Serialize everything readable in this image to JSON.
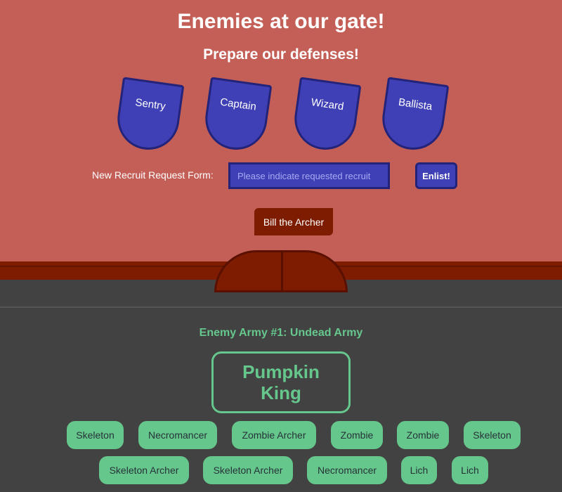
{
  "header": {
    "title": "Enemies at our gate!",
    "subtitle": "Prepare our defenses!"
  },
  "defenders": [
    {
      "label": "Sentry"
    },
    {
      "label": "Captain"
    },
    {
      "label": "Wizard"
    },
    {
      "label": "Ballista"
    }
  ],
  "recruit_form": {
    "label": "New Recruit Request Form:",
    "placeholder": "Please indicate requested recruit",
    "value": "",
    "enlist_label": "Enlist!"
  },
  "recruit": {
    "label": "Bill the Archer"
  },
  "enemy_army": {
    "title": "Enemy Army #1: Undead Army",
    "boss": "Pumpkin King",
    "units": [
      {
        "label": "Skeleton"
      },
      {
        "label": "Necromancer"
      },
      {
        "label": "Zombie Archer"
      },
      {
        "label": "Zombie"
      },
      {
        "label": "Zombie"
      },
      {
        "label": "Skeleton"
      },
      {
        "label": "Skeleton Archer"
      },
      {
        "label": "Skeleton Archer"
      },
      {
        "label": "Necromancer"
      },
      {
        "label": "Lich"
      },
      {
        "label": "Lich"
      }
    ]
  },
  "colors": {
    "castle_red": "#c45f57",
    "wall_brown": "#7d1c00",
    "shield_blue": "#3f40b5",
    "shield_border": "#23237a",
    "army_bg": "#424242",
    "army_green": "#66c78d"
  }
}
